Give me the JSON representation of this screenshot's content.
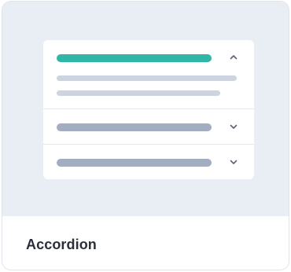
{
  "card": {
    "title": "Accordion"
  },
  "preview": {
    "accordion_sections": [
      {
        "state": "expanded",
        "chevron_icon": "chevron-up-icon"
      },
      {
        "state": "collapsed",
        "chevron_icon": "chevron-down-icon"
      },
      {
        "state": "collapsed",
        "chevron_icon": "chevron-down-icon"
      }
    ]
  },
  "colors": {
    "accent": "#2fb6a6",
    "preview_background": "#e9edf4",
    "collapsed_bar": "#a2adc1",
    "content_line": "#cdd3df",
    "title_text": "#2a2f3a"
  }
}
